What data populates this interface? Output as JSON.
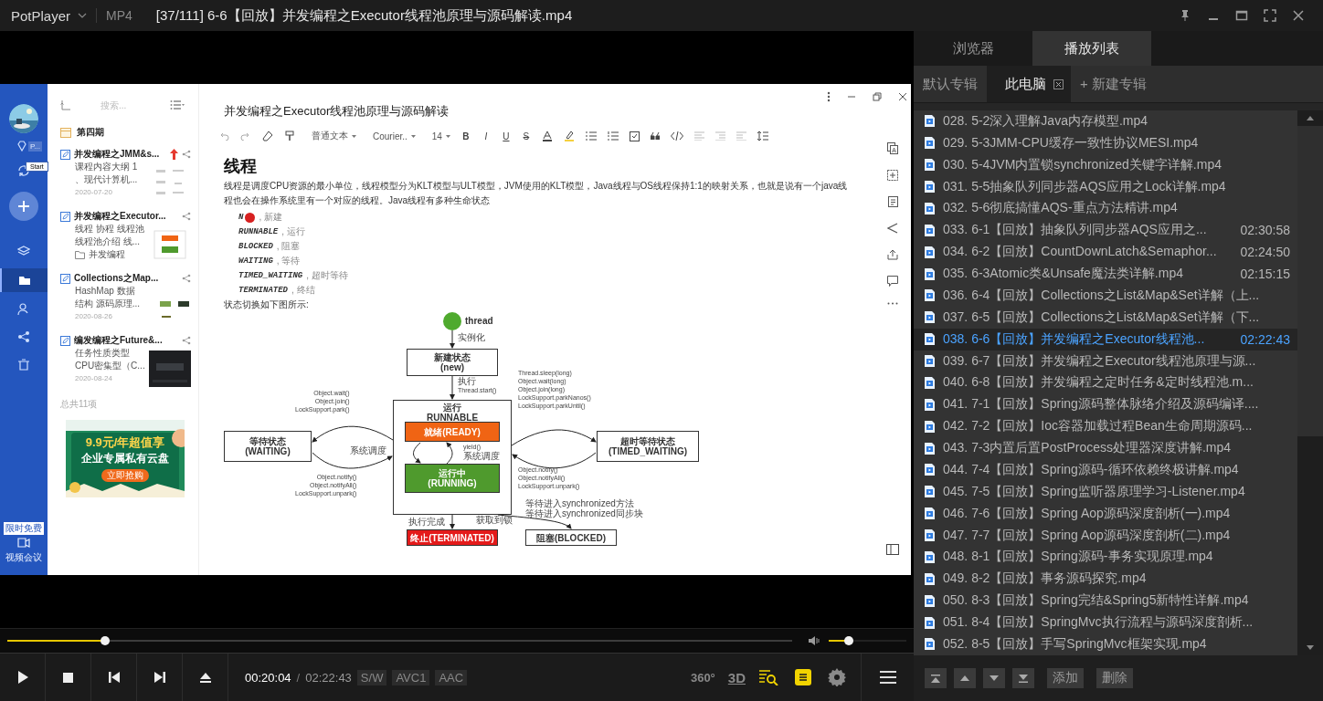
{
  "title_bar": {
    "app": "PotPlayer",
    "format": "MP4",
    "title": "[37/111] 6-6【回放】并发编程之Executor线程池原理与源码解读.mp4"
  },
  "video_frame": {
    "sidebar": {
      "item_label": "P...",
      "tooltip": "Start",
      "promo_badge": "限时免费",
      "meeting_label": "视频会议"
    },
    "note_list": {
      "search_placeholder": "搜索...",
      "folder": "第四期",
      "total": "总共11项",
      "notes": [
        {
          "title": "并发编程之JMM&s...",
          "pinned": true,
          "lines": [
            "课程内容大纲 1",
            "、现代计算机..."
          ],
          "date": "2020-07-20"
        },
        {
          "title": "并发编程之Executor...",
          "pinned": false,
          "lines": [
            "线程 协程 线程池",
            "线程池介绍 线..."
          ],
          "folder": "并发编程"
        },
        {
          "title": "Collections之Map...",
          "pinned": false,
          "lines": [
            "HashMap 数据",
            "结构 源码原理..."
          ],
          "date": "2020-08-26"
        },
        {
          "title": "编发编程之Future&...",
          "pinned": false,
          "lines": [
            "任务性质类型",
            "CPU密集型（C..."
          ],
          "date": "2020-08-24"
        }
      ],
      "ad": {
        "price": "9.9元/年超值享",
        "headline": "企业专属私有云盘",
        "cta": "立即抢购"
      }
    },
    "document": {
      "title": "并发编程之Executor线程池原理与源码解读",
      "toolbar": {
        "style": "普通文本",
        "font": "Courier..",
        "size": "14",
        "format_buttons": [
          {
            "label": "B",
            "kind": "bold"
          },
          {
            "label": "I",
            "kind": "italic"
          },
          {
            "label": "U",
            "kind": "underline"
          },
          {
            "label": "S",
            "kind": "strike"
          }
        ]
      },
      "heading": "线程",
      "paragraph": "线程是调度CPU资源的最小单位，线程模型分为KLT模型与ULT模型，JVM使用的KLT模型，Java线程与OS线程保持1:1的映射关系，也就是说有一个java线程也会在操作系统里有一个对应的线程。Java线程有多种生命状态",
      "states": [
        {
          "code": "N",
          "desc": ", 新建",
          "cursor": true
        },
        {
          "code": "RUNNABLE",
          "desc": ", 运行"
        },
        {
          "code": "BLOCKED",
          "desc": ", 阻塞"
        },
        {
          "code": "WAITING",
          "desc": ", 等待"
        },
        {
          "code": "TIMED_WAITING",
          "desc": ", 超时等待"
        },
        {
          "code": "TERMINATED",
          "desc": ", 终结"
        }
      ],
      "caption": "状态切换如下图所示:",
      "diagram": {
        "start_label": "thread",
        "nodes": [
          {
            "kind": "plain",
            "lines": [
              "新建状态",
              "(new)"
            ]
          },
          {
            "kind": "group",
            "lines": [
              "运行",
              "RUNNABLE"
            ]
          },
          {
            "kind": "ready",
            "lines": [
              "就绪(READY)"
            ]
          },
          {
            "kind": "running",
            "lines": [
              "运行中",
              "(RUNNING)"
            ]
          },
          {
            "kind": "plain",
            "lines": [
              "等待状态",
              "(WAITING)"
            ]
          },
          {
            "kind": "plain",
            "lines": [
              "超时等待状态",
              "(TIMED_WAITING)"
            ]
          },
          {
            "kind": "terminated",
            "lines": [
              "终止(TERMINATED)"
            ]
          },
          {
            "kind": "plain",
            "lines": [
              "阻塞(BLOCKED)"
            ]
          }
        ],
        "edge_labels": [
          [
            "实例化"
          ],
          [
            "执行",
            "Thread.start()"
          ],
          [
            "Object.wait()",
            "Object.join()",
            "LockSupport.park()"
          ],
          [
            "Object.notify()",
            "Object.notifyAll()",
            "LockSupport.unpark()"
          ],
          [
            "Thread.sleep(long)",
            "Object.wait(long)",
            "Object.join(long)",
            "LockSupport.parkNanos()",
            "LockSupport.parkUntil()"
          ],
          [
            "Object.notify()",
            "Object.notifyAll()",
            "LockSupport.unpark()"
          ],
          [
            "系统调度"
          ],
          [
            "yield()",
            "系统调度"
          ],
          [
            "执行完成"
          ],
          [
            "获取到锁"
          ],
          [
            "等待进入synchronized方法",
            "等待进入synchronized同步块"
          ]
        ]
      }
    }
  },
  "controls": {
    "seek": {
      "level": 0.125
    },
    "volume": {
      "level": 0.26
    },
    "elapsed": "00:20:04",
    "separator": "/",
    "duration": "02:22:43",
    "badges": [
      "S/W",
      "AVC1",
      "AAC"
    ],
    "mode_360": "360°",
    "mode_3d": "3D",
    "toggles": [
      {
        "kind": "playlist-search",
        "on": true
      },
      {
        "kind": "subtitles",
        "on": true
      }
    ]
  },
  "panel": {
    "tabs": [
      {
        "label": "浏览器",
        "selected": false
      },
      {
        "label": "播放列表",
        "selected": true
      }
    ],
    "albums": [
      {
        "label": "默认专辑",
        "selected": false
      },
      {
        "label": "此电脑",
        "selected": true
      }
    ],
    "new_album": "+ 新建专辑",
    "items": [
      {
        "name": "028. 5-2深入理解Java内存模型.mp4",
        "selected": false
      },
      {
        "name": "029. 5-3JMM-CPU缓存一致性协议MESI.mp4",
        "selected": false
      },
      {
        "name": "030. 5-4JVM内置锁synchronized关键字详解.mp4",
        "selected": false
      },
      {
        "name": "031. 5-5抽象队列同步器AQS应用之Lock详解.mp4",
        "selected": false
      },
      {
        "name": "032. 5-6彻底搞懂AQS-重点方法精讲.mp4",
        "selected": false
      },
      {
        "name": "033. 6-1【回放】抽象队列同步器AQS应用之...",
        "duration": "02:30:58",
        "selected": false
      },
      {
        "name": "034. 6-2【回放】CountDownLatch&Semaphor...",
        "duration": "02:24:50",
        "selected": false
      },
      {
        "name": "035. 6-3Atomic类&Unsafe魔法类详解.mp4",
        "duration": "02:15:15",
        "selected": false
      },
      {
        "name": "036. 6-4【回放】Collections之List&Map&Set详解（上...",
        "selected": false
      },
      {
        "name": "037. 6-5【回放】Collections之List&Map&Set详解（下...",
        "selected": false
      },
      {
        "name": "038. 6-6【回放】并发编程之Executor线程池...",
        "duration": "02:22:43",
        "selected": true
      },
      {
        "name": "039. 6-7【回放】并发编程之Executor线程池原理与源...",
        "selected": false
      },
      {
        "name": "040. 6-8【回放】并发编程之定时任务&定时线程池.m...",
        "selected": false
      },
      {
        "name": "041. 7-1【回放】Spring源码整体脉络介绍及源码编译....",
        "selected": false
      },
      {
        "name": "042. 7-2【回放】Ioc容器加载过程Bean生命周期源码...",
        "selected": false
      },
      {
        "name": "043. 7-3内置后置PostProcess处理器深度讲解.mp4",
        "selected": false
      },
      {
        "name": "044. 7-4【回放】Spring源码-循环依赖终极讲解.mp4",
        "selected": false
      },
      {
        "name": "045. 7-5【回放】Spring监听器原理学习-Listener.mp4",
        "selected": false
      },
      {
        "name": "046. 7-6【回放】Spring Aop源码深度剖析(一).mp4",
        "selected": false
      },
      {
        "name": "047. 7-7【回放】Spring Aop源码深度剖析(二).mp4",
        "selected": false
      },
      {
        "name": "048. 8-1【回放】Spring源码-事务实现原理.mp4",
        "selected": false
      },
      {
        "name": "049. 8-2【回放】事务源码探究.mp4",
        "selected": false
      },
      {
        "name": "050. 8-3【回放】Spring完结&Spring5新特性详解.mp4",
        "selected": false
      },
      {
        "name": "051. 8-4【回放】SpringMvc执行流程与源码深度剖析...",
        "selected": false
      },
      {
        "name": "052. 8-5【回放】手写SpringMvc框架实现.mp4",
        "selected": false
      }
    ],
    "buttons": [
      "添加",
      "删除"
    ]
  }
}
